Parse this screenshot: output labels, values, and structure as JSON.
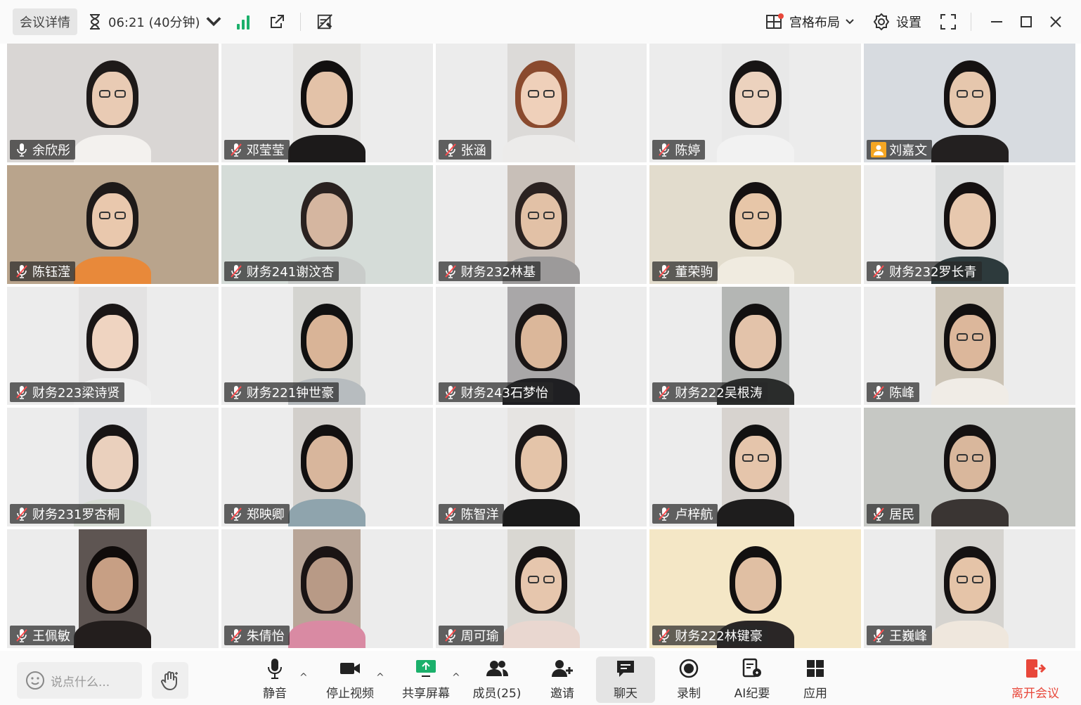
{
  "topbar": {
    "details_label": "会议详情",
    "timer_text": "06:21 (40分钟)",
    "layout_label": "宫格布局",
    "settings_label": "设置"
  },
  "participants": [
    {
      "name": "余欣彤",
      "mic": "on"
    },
    {
      "name": "邓莹莹",
      "mic": "muted"
    },
    {
      "name": "张涵",
      "mic": "muted"
    },
    {
      "name": "陈婷",
      "mic": "muted"
    },
    {
      "name": "刘嘉文",
      "mic": "host"
    },
    {
      "name": "陈钰滢",
      "mic": "muted"
    },
    {
      "name": "财务241谢汶杏",
      "mic": "muted"
    },
    {
      "name": "财务232林基",
      "mic": "muted"
    },
    {
      "name": "董荣驹",
      "mic": "muted"
    },
    {
      "name": "财务232罗长青",
      "mic": "muted"
    },
    {
      "name": "财务223梁诗贤",
      "mic": "muted"
    },
    {
      "name": "财务221钟世豪",
      "mic": "muted"
    },
    {
      "name": "财务243石梦怡",
      "mic": "muted"
    },
    {
      "name": "财务222吴根涛",
      "mic": "muted"
    },
    {
      "name": "陈峰",
      "mic": "muted"
    },
    {
      "name": "财务231罗杏桐",
      "mic": "muted"
    },
    {
      "name": "郑映卿",
      "mic": "muted"
    },
    {
      "name": "陈智洋",
      "mic": "muted"
    },
    {
      "name": "卢梓航",
      "mic": "muted"
    },
    {
      "name": "居民",
      "mic": "muted"
    },
    {
      "name": "王佩敏",
      "mic": "muted"
    },
    {
      "name": "朱倩怡",
      "mic": "muted"
    },
    {
      "name": "周可瑜",
      "mic": "muted"
    },
    {
      "name": "财务222林键豪",
      "mic": "muted"
    },
    {
      "name": "王巍峰",
      "mic": "muted"
    }
  ],
  "bottombar": {
    "chat_placeholder": "说点什么...",
    "mute_label": "静音",
    "stop_video_label": "停止视频",
    "share_label": "共享屏幕",
    "members_label": "成员(25)",
    "invite_label": "邀请",
    "chat_label": "聊天",
    "record_label": "录制",
    "ai_label": "AI纪要",
    "apps_label": "应用",
    "leave_label": "离开会议"
  },
  "colors": {
    "signal": "#1bb06b",
    "leave": "#e8473a",
    "host_badge": "#f5a623",
    "share_icon": "#1bb06b"
  }
}
